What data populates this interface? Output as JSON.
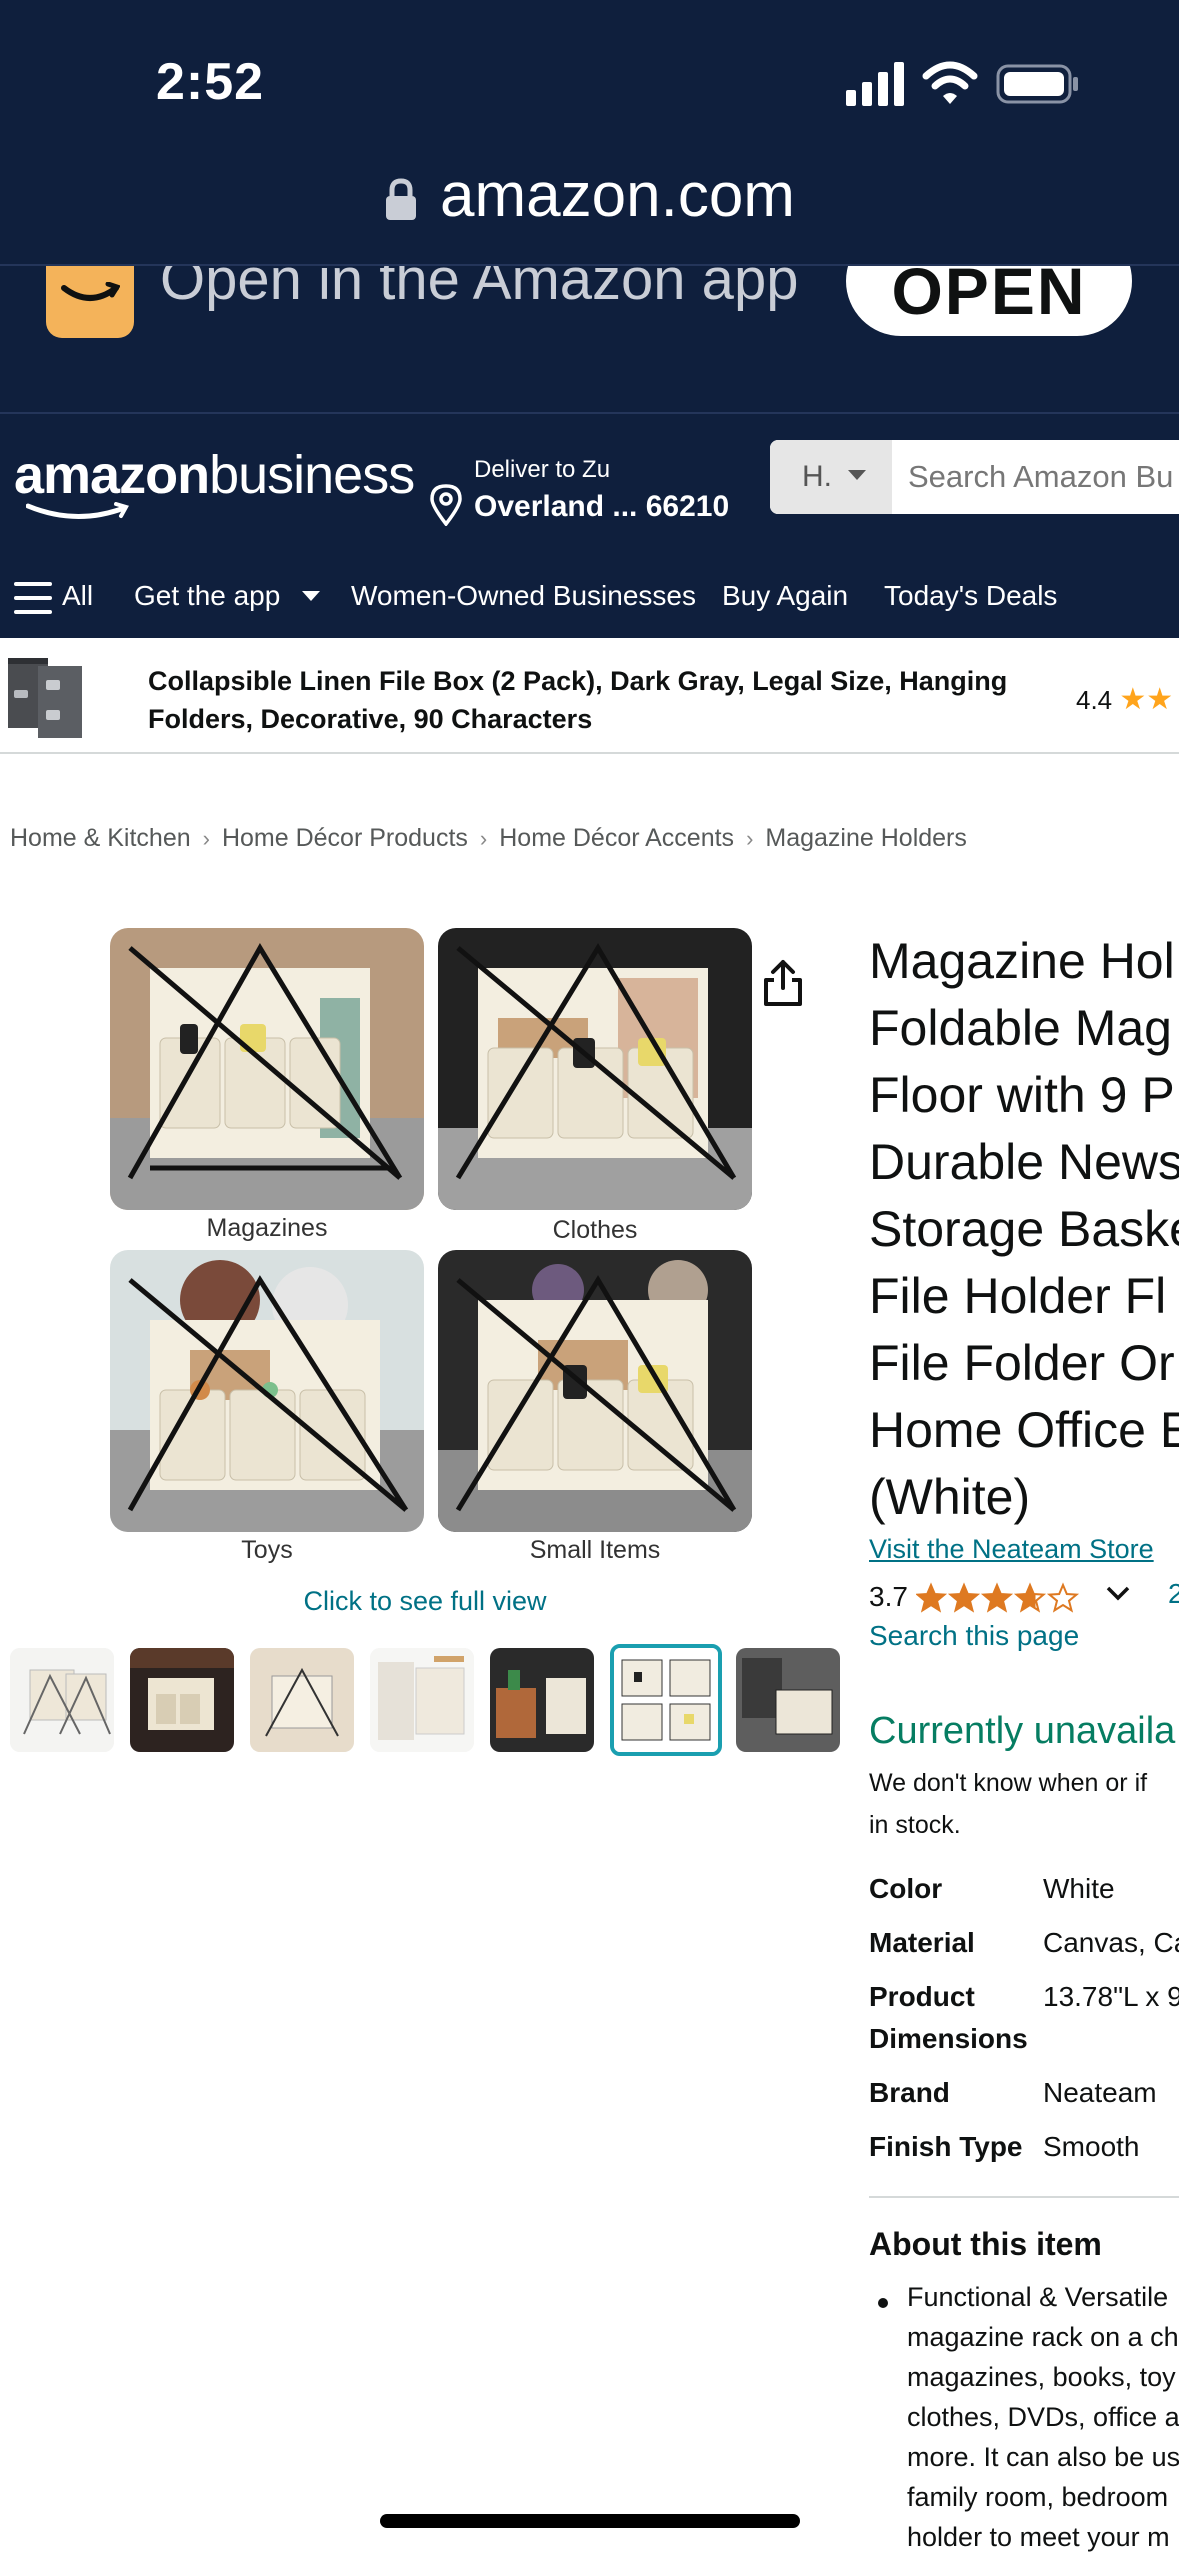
{
  "status_bar": {
    "time": "2:52"
  },
  "browser": {
    "url": "amazon.com"
  },
  "app_banner": {
    "text": "Open in the Amazon app",
    "open_label": "OPEN"
  },
  "header": {
    "logo_main": "amazon",
    "logo_sub": "business",
    "deliver_line1": "Deliver to Zu",
    "deliver_line2": "Overland ... 66210",
    "search_category": "H.",
    "search_placeholder": "Search Amazon Bu"
  },
  "nav": {
    "all": "All",
    "get_app": "Get the app",
    "women_owned": "Women-Owned Businesses",
    "buy_again": "Buy Again",
    "todays_deals": "Today's Deals"
  },
  "sticky_product": {
    "title": "Collapsible Linen File Box (2 Pack), Dark Gray, Legal Size, Hanging Folders, Decorative, 90 Characters",
    "rating": "4.4"
  },
  "breadcrumb": [
    "Home & Kitchen",
    "Home Décor Products",
    "Home Décor Accents",
    "Magazine Holders"
  ],
  "gallery": {
    "labels": [
      "Magazines",
      "Clothes",
      "Toys",
      "Small Items"
    ],
    "full_view": "Click to see full view",
    "selected_thumb_index": 5,
    "thumb_count": 7
  },
  "product": {
    "title_lines": [
      "Magazine Hol",
      "Foldable Mag",
      "Floor with 9 P",
      "Durable News",
      "Storage Baske",
      "File Holder Fl",
      "File Folder Or",
      "Home Office E",
      "(White)"
    ],
    "store_link": "Visit the Neateam Store",
    "rating_value": "3.7",
    "rating_stars": 3.7,
    "rating_count_partial": "2",
    "search_page": "Search this page",
    "availability": "Currently unavaila",
    "availability_note": "We don't know when or if this item will be back in stock.",
    "availability_note_lines": [
      "We don't know when or if",
      "in stock."
    ],
    "specs": [
      {
        "key": "Color",
        "value": "White"
      },
      {
        "key": "Material",
        "value": "Canvas, Ca"
      },
      {
        "key": "Product Dimensions",
        "key_lines": [
          "Product",
          "Dimensions"
        ],
        "value": "13.78\"L x 9"
      },
      {
        "key": "Brand",
        "value": "Neateam"
      },
      {
        "key": "Finish Type",
        "value": "Smooth"
      }
    ],
    "about_heading": "About this item",
    "about_lines": [
      "Functional & Versatile",
      "magazine rack on a ch",
      "magazines, books, toy",
      "clothes, DVDs, office a",
      "more. It can also be us",
      "family room, bedroom",
      "holder to meet your m"
    ]
  },
  "colors": {
    "header_bg": "#0f1f3d",
    "link": "#007185",
    "star": "#de7921",
    "available_green": "#067d62",
    "selected_thumb_border": "#1a9fb0"
  }
}
